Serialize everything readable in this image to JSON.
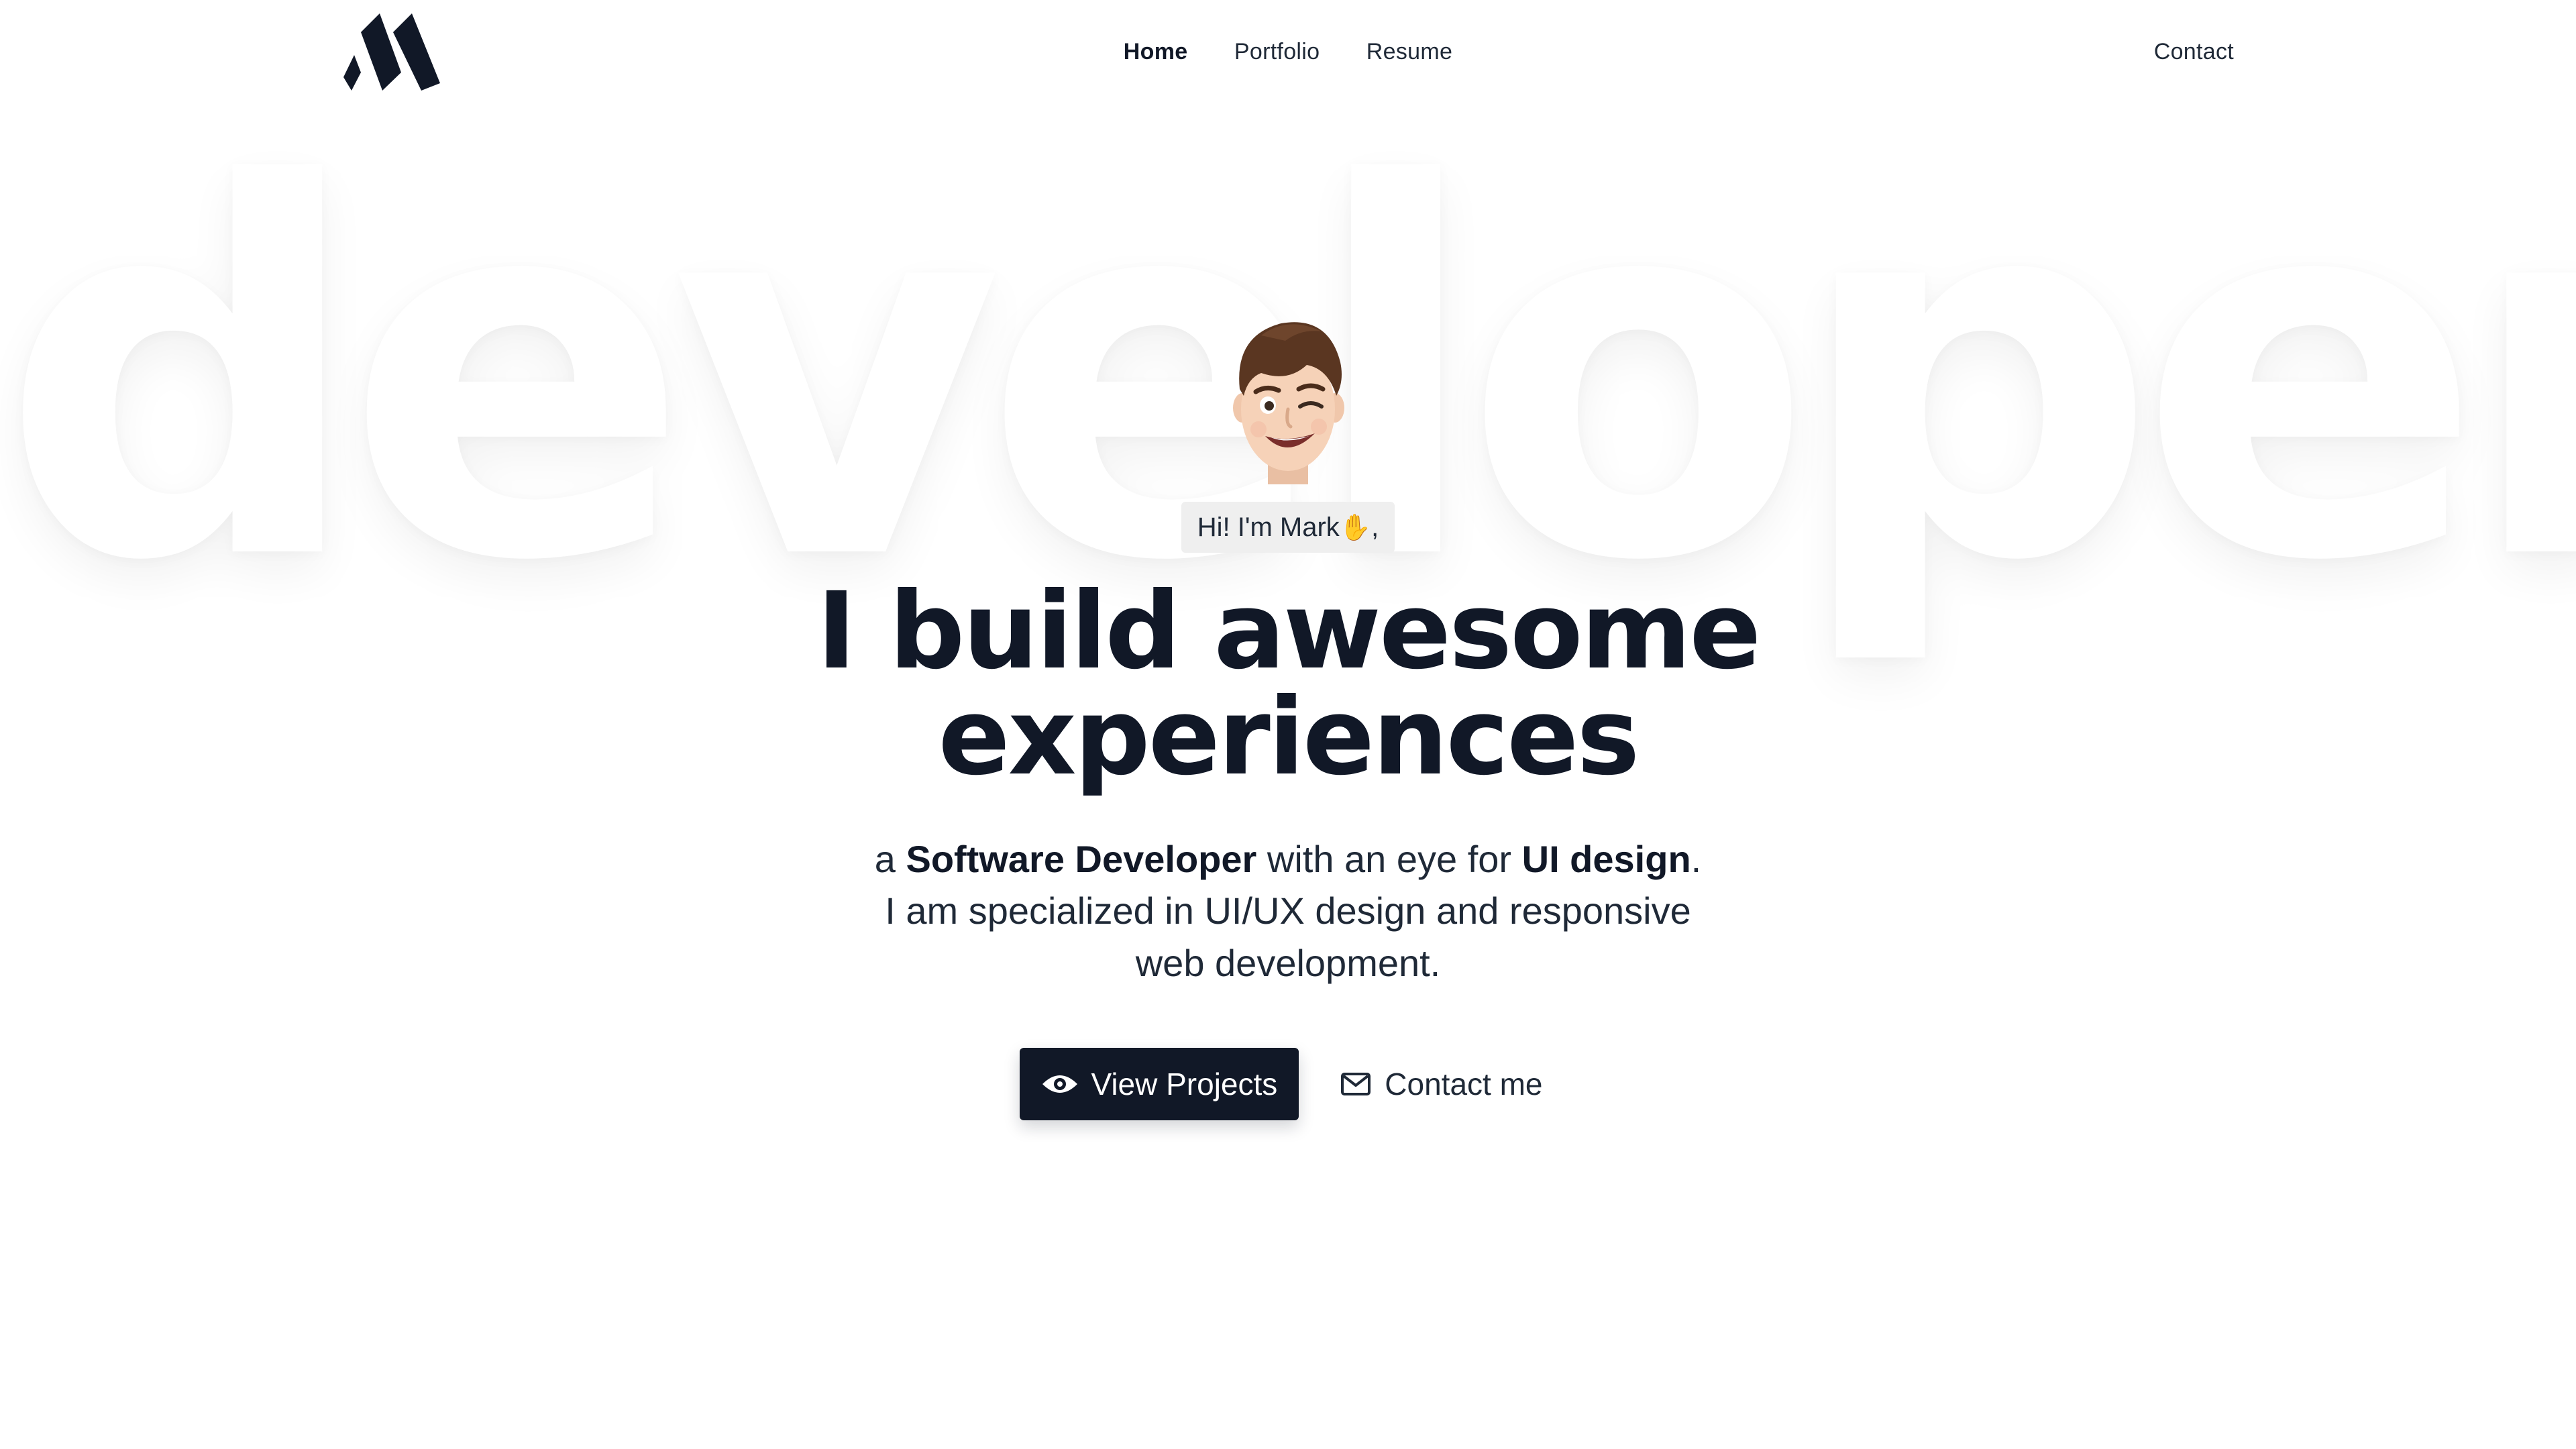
{
  "nav": {
    "logo_alt": "M",
    "links": [
      {
        "label": "Home",
        "active": true
      },
      {
        "label": "Portfolio",
        "active": false
      },
      {
        "label": "Resume",
        "active": false
      }
    ],
    "contact_label": "Contact"
  },
  "background_word": "developer",
  "hero": {
    "greeting": "Hi! I'm Mark",
    "greeting_suffix": ",",
    "greeting_emoji": "waving-hand",
    "headline_line1": "I build awesome",
    "headline_line2": "experiences",
    "subtitle": {
      "prefix": "a ",
      "strong1": "Software Developer",
      "mid": " with an eye for ",
      "strong2": "UI design",
      "end": ".",
      "line2": "I am specialized in UI/UX design and responsive",
      "line3": "web development."
    }
  },
  "cta": {
    "primary_label": "View Projects",
    "primary_icon": "eye-icon",
    "secondary_label": "Contact me",
    "secondary_icon": "mail-icon"
  },
  "colors": {
    "text_dark": "#111827",
    "button_bg": "#111827",
    "greeting_bg": "#efefef",
    "background": "#ffffff"
  }
}
